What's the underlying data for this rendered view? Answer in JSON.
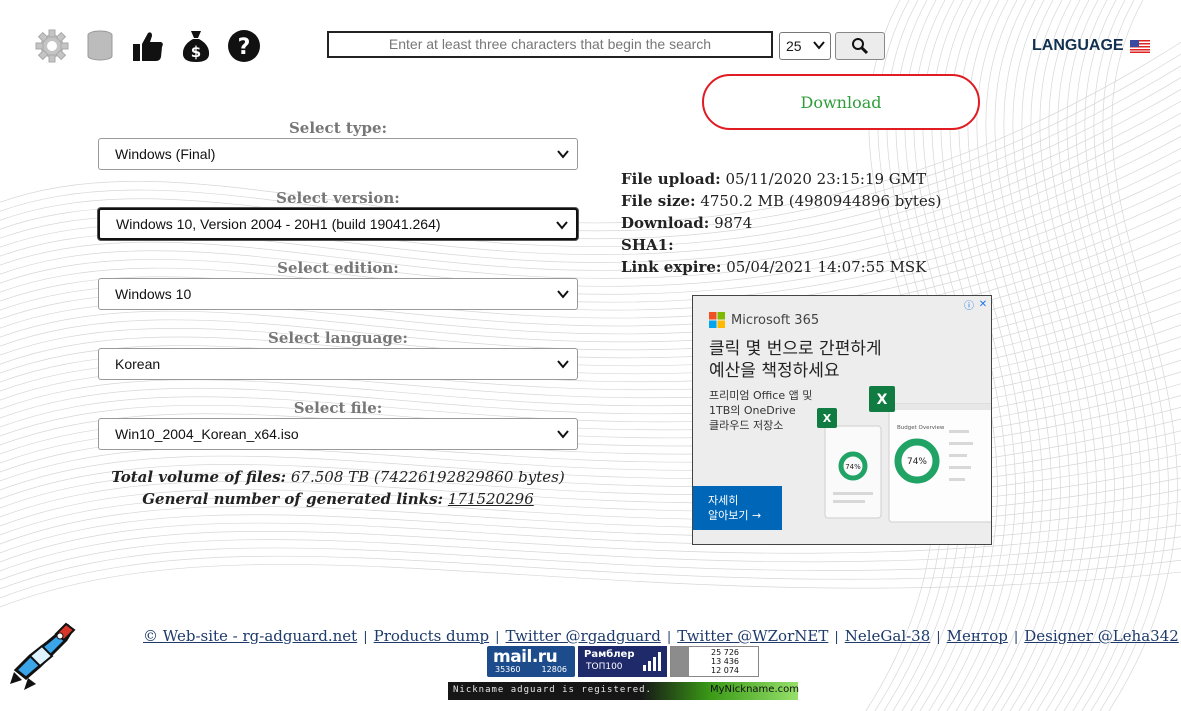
{
  "toolbar": {
    "icons": [
      "gear-icon",
      "database-icon",
      "thumbs-up-icon",
      "money-bag-icon",
      "help-icon"
    ]
  },
  "search": {
    "placeholder": "Enter at least three characters that begin the search",
    "count": "25",
    "button_icon": "search-icon"
  },
  "language": {
    "label": "LANGUAGE",
    "flag": "us-flag-icon"
  },
  "download": {
    "label": "Download",
    "color": "#2e9d3a",
    "border_color": "#e01b22"
  },
  "form": {
    "type": {
      "label": "Select type:",
      "value": "Windows (Final)"
    },
    "version": {
      "label": "Select version:",
      "value": "Windows 10, Version 2004 - 20H1 (build 19041.264)"
    },
    "edition": {
      "label": "Select edition:",
      "value": "Windows 10"
    },
    "language": {
      "label": "Select language:",
      "value": "Korean"
    },
    "file": {
      "label": "Select file:",
      "value": "Win10_2004_Korean_x64.iso"
    }
  },
  "totals": {
    "volume_label": "Total volume of files:",
    "volume_value": "67.508 TB (74226192829860 bytes)",
    "links_label": "General number of generated links:",
    "links_value": "171520296"
  },
  "file_info": {
    "upload_label": "File upload:",
    "upload_value": "05/11/2020 23:15:19 GMT",
    "size_label": "File size:",
    "size_value": "4750.2 MB (4980944896 bytes)",
    "download_label": "Download:",
    "download_value": "9874",
    "sha1_label": "SHA1:",
    "sha1_value": "",
    "expire_label": "Link expire:",
    "expire_value": "05/04/2021 14:07:55 MSK"
  },
  "ad": {
    "brand": "Microsoft 365",
    "headline_1": "클릭 몇 번으로 간편하게",
    "headline_2": "예산을 책정하세요",
    "sub_1": "프리미엄 Office 앱 및",
    "sub_2": "1TB의 OneDrive",
    "sub_3": "클라우드 저장소",
    "cta_1": "자세히",
    "cta_2": "알아보기 →",
    "pct_a": "74%",
    "pct_b": "74%",
    "card_title": "Budget Overview"
  },
  "footer": {
    "links": [
      "© Web-site - rg-adguard.net",
      "Products dump",
      "Twitter @rgadguard",
      "Twitter @WZorNET",
      "NeleGal-38",
      "Ментор",
      "Designer @Leha342"
    ]
  },
  "counters": {
    "mail_title": "mail.ru",
    "mail_a": "35360",
    "mail_b": "12806",
    "rambler_title": "Рамблер",
    "rambler_sub": "ТОП100",
    "li_1": "25 726",
    "li_2": "13 436",
    "li_3": "12 074"
  },
  "nickname": {
    "left": "Nickname adguard is registered.",
    "right": "MyNickname.com"
  }
}
